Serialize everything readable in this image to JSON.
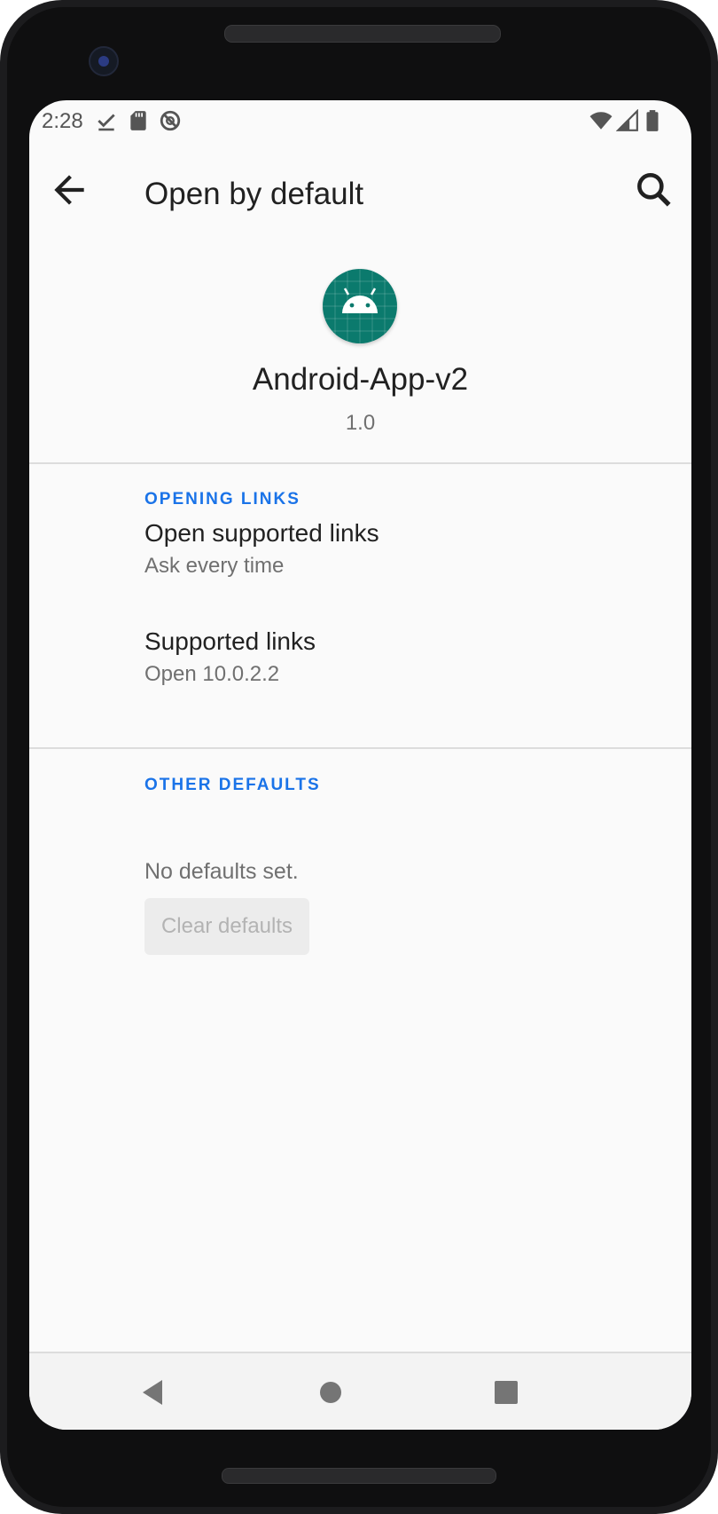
{
  "status_bar": {
    "time": "2:28",
    "left_icons": [
      "download-done-icon",
      "sd-card-icon",
      "do-not-disturb-icon"
    ],
    "right_icons": [
      "wifi-icon",
      "cell-signal-icon",
      "battery-icon"
    ]
  },
  "toolbar": {
    "title": "Open by default",
    "back_icon": "arrow-back-icon",
    "search_icon": "search-icon"
  },
  "app": {
    "name": "Android-App-v2",
    "version": "1.0",
    "icon": "android-app-icon"
  },
  "sections": {
    "opening_links": {
      "header": "OPENING LINKS",
      "items": [
        {
          "title": "Open supported links",
          "summary": "Ask every time"
        },
        {
          "title": "Supported links",
          "summary": "Open 10.0.2.2"
        }
      ]
    },
    "other_defaults": {
      "header": "OTHER DEFAULTS",
      "status": "No defaults set.",
      "button_label": "Clear defaults"
    }
  },
  "nav_bar": {
    "buttons": [
      "back-triangle-icon",
      "home-circle-icon",
      "recents-square-icon"
    ]
  },
  "colors": {
    "accent": "#1a73e8",
    "app_icon_bg": "#0b7a6d",
    "screen_bg": "#fafafa",
    "frame": "#1c1c1e"
  }
}
